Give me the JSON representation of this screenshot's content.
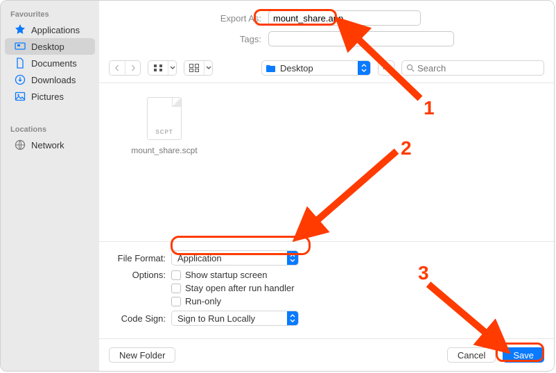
{
  "sidebar": {
    "favourites_label": "Favourites",
    "locations_label": "Locations",
    "items": [
      {
        "label": "Applications"
      },
      {
        "label": "Desktop"
      },
      {
        "label": "Documents"
      },
      {
        "label": "Downloads"
      },
      {
        "label": "Pictures"
      }
    ],
    "locations": [
      {
        "label": "Network"
      }
    ]
  },
  "form": {
    "export_label": "Export As:",
    "export_value": "mount_share.app",
    "tags_label": "Tags:",
    "tags_value": ""
  },
  "toolbar": {
    "location": "Desktop",
    "search_placeholder": "Search"
  },
  "browser": {
    "file_tag": "SCPT",
    "file_name": "mount_share.scpt"
  },
  "options": {
    "file_format_label": "File Format:",
    "file_format_value": "Application",
    "options_label": "Options:",
    "opt_show_startup": "Show startup screen",
    "opt_stay_open": "Stay open after run handler",
    "opt_run_only": "Run-only",
    "code_sign_label": "Code Sign:",
    "code_sign_value": "Sign to Run Locally"
  },
  "buttons": {
    "new_folder": "New Folder",
    "cancel": "Cancel",
    "save": "Save"
  },
  "annotations": {
    "n1": "1",
    "n2": "2",
    "n3": "3"
  }
}
